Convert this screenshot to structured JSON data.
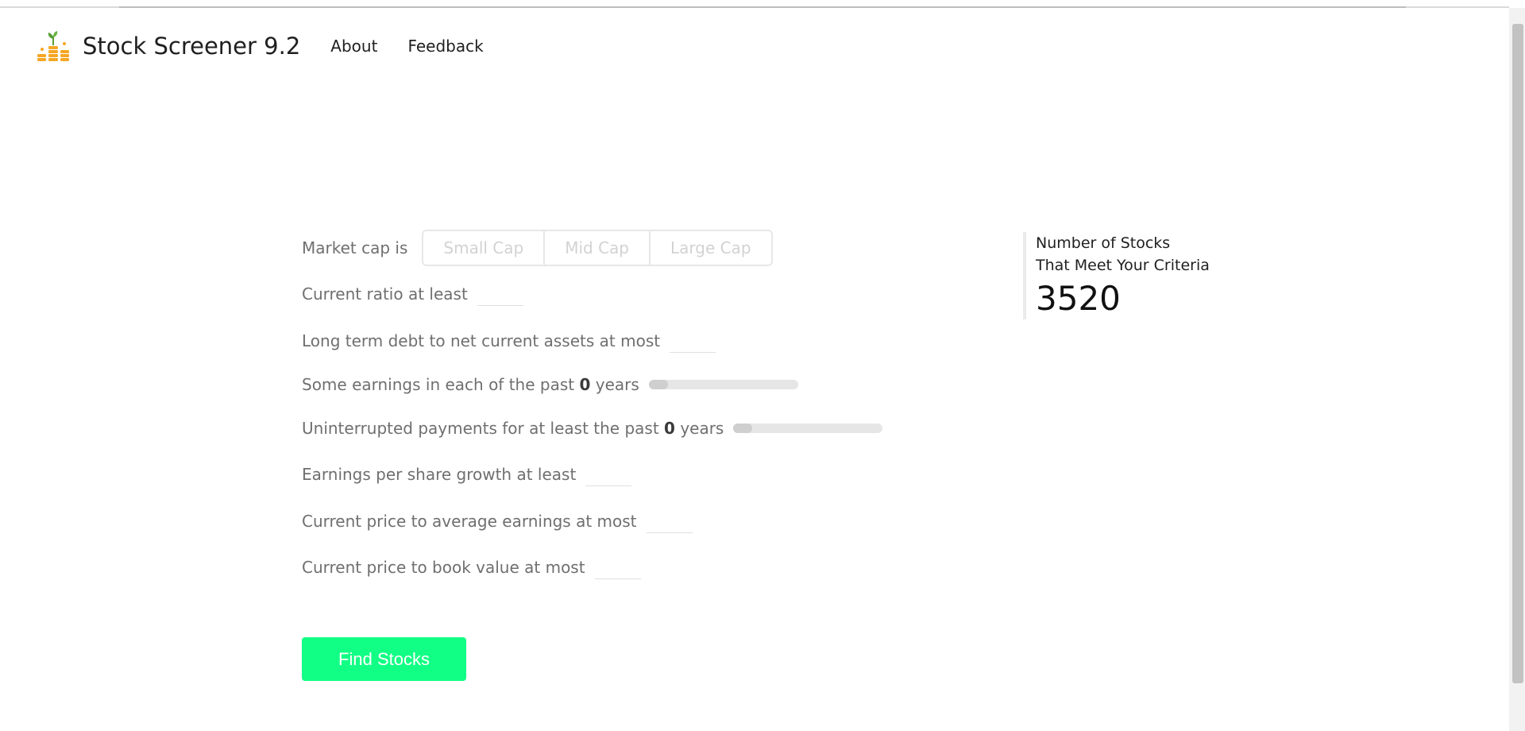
{
  "app": {
    "title": "Stock Screener 9.2"
  },
  "nav": {
    "about": "About",
    "feedback": "Feedback"
  },
  "form": {
    "market_cap_label": "Market cap is",
    "market_cap_options": [
      "Small Cap",
      "Mid Cap",
      "Large Cap"
    ],
    "current_ratio_label": "Current ratio at least",
    "debt_label": "Long term debt to net current assets at most",
    "earnings_label_pre": "Some earnings in each of the past",
    "earnings_years": "0",
    "earnings_label_post": "years",
    "earnings_slider_value": 0,
    "payments_label_pre": "Uninterrupted payments for at least the past",
    "payments_years": "0",
    "payments_label_post": "years",
    "payments_slider_value": 0,
    "eps_label": "Earnings per share growth at least",
    "pe_label": "Current price to average earnings at most",
    "pb_label": "Current price to book value at most",
    "find_button": "Find Stocks"
  },
  "counter": {
    "line1": "Number of Stocks",
    "line2": "That Meet Your Criteria",
    "value": "3520"
  },
  "colors": {
    "accent": "#11ff84",
    "logo_coin": "#f5a623",
    "logo_leaf": "#5a9e3a"
  },
  "icons": {
    "logo": "coin-stack-plant-icon"
  }
}
